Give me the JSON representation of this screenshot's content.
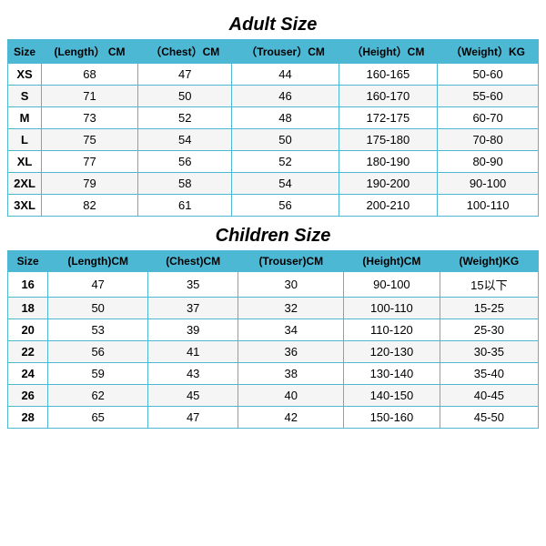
{
  "adult": {
    "title": "Adult Size",
    "headers": [
      "Size",
      "(Length） CM",
      "（Chest）CM",
      "（Trouser）CM",
      "（Height）CM",
      "（Weight）KG"
    ],
    "rows": [
      [
        "XS",
        "68",
        "47",
        "44",
        "160-165",
        "50-60"
      ],
      [
        "S",
        "71",
        "50",
        "46",
        "160-170",
        "55-60"
      ],
      [
        "M",
        "73",
        "52",
        "48",
        "172-175",
        "60-70"
      ],
      [
        "L",
        "75",
        "54",
        "50",
        "175-180",
        "70-80"
      ],
      [
        "XL",
        "77",
        "56",
        "52",
        "180-190",
        "80-90"
      ],
      [
        "2XL",
        "79",
        "58",
        "54",
        "190-200",
        "90-100"
      ],
      [
        "3XL",
        "82",
        "61",
        "56",
        "200-210",
        "100-110"
      ]
    ]
  },
  "children": {
    "title": "Children Size",
    "headers": [
      "Size",
      "(Length)CM",
      "(Chest)CM",
      "(Trouser)CM",
      "(Height)CM",
      "(Weight)KG"
    ],
    "rows": [
      [
        "16",
        "47",
        "35",
        "30",
        "90-100",
        "15以下"
      ],
      [
        "18",
        "50",
        "37",
        "32",
        "100-110",
        "15-25"
      ],
      [
        "20",
        "53",
        "39",
        "34",
        "110-120",
        "25-30"
      ],
      [
        "22",
        "56",
        "41",
        "36",
        "120-130",
        "30-35"
      ],
      [
        "24",
        "59",
        "43",
        "38",
        "130-140",
        "35-40"
      ],
      [
        "26",
        "62",
        "45",
        "40",
        "140-150",
        "40-45"
      ],
      [
        "28",
        "65",
        "47",
        "42",
        "150-160",
        "45-50"
      ]
    ]
  }
}
